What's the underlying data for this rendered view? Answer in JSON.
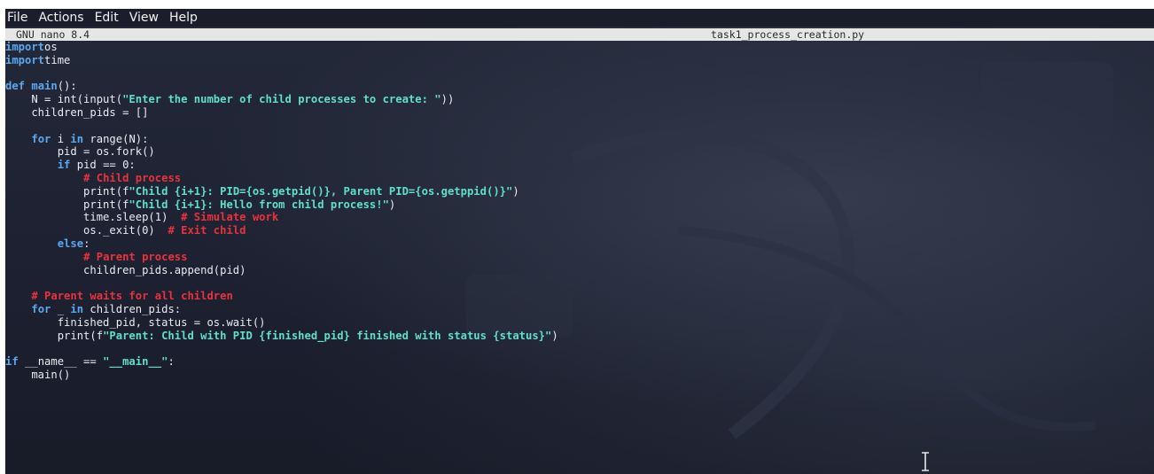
{
  "menu": {
    "items": [
      "File",
      "Actions",
      "Edit",
      "View",
      "Help"
    ]
  },
  "nano": {
    "version": "GNU nano 8.4",
    "filename": "task1_process_creation.py"
  },
  "editor": {
    "lines": [
      [
        [
          "kw",
          "import"
        ],
        [
          "",
          "os"
        ]
      ],
      [
        [
          "kw",
          "import"
        ],
        [
          "",
          "time"
        ]
      ],
      [],
      [
        [
          "kw",
          "def"
        ],
        [
          "",
          " "
        ],
        [
          "fn",
          "main"
        ],
        [
          "",
          "():"
        ]
      ],
      [
        [
          "",
          "    N = int(input("
        ],
        [
          "str",
          "\"Enter the number of child processes to create: \""
        ],
        [
          "",
          "))"
        ]
      ],
      [
        [
          "",
          "    children_pids = []"
        ]
      ],
      [],
      [
        [
          "",
          "    "
        ],
        [
          "kw",
          "for"
        ],
        [
          "",
          " i "
        ],
        [
          "kw",
          "in"
        ],
        [
          "",
          " range(N):"
        ]
      ],
      [
        [
          "",
          "        pid = os.fork()"
        ]
      ],
      [
        [
          "",
          "        "
        ],
        [
          "kw",
          "if"
        ],
        [
          "",
          " pid == 0:"
        ]
      ],
      [
        [
          "",
          "            "
        ],
        [
          "cm",
          "# Child process"
        ]
      ],
      [
        [
          "",
          "            print(f"
        ],
        [
          "str",
          "\"Child {i+1}: PID={os.getpid()}, Parent PID={os.getppid()}\""
        ],
        [
          "",
          ")"
        ]
      ],
      [
        [
          "",
          "            print(f"
        ],
        [
          "str",
          "\"Child {i+1}: Hello from child process!\""
        ],
        [
          "",
          ")"
        ]
      ],
      [
        [
          "",
          "            time.sleep(1)  "
        ],
        [
          "cm",
          "# Simulate work"
        ]
      ],
      [
        [
          "",
          "            os._exit(0)  "
        ],
        [
          "cm",
          "# Exit child"
        ]
      ],
      [
        [
          "",
          "        "
        ],
        [
          "kw",
          "else"
        ],
        [
          "",
          ":"
        ]
      ],
      [
        [
          "",
          "            "
        ],
        [
          "cm",
          "# Parent process"
        ]
      ],
      [
        [
          "",
          "            children_pids.append(pid)"
        ]
      ],
      [],
      [
        [
          "",
          "    "
        ],
        [
          "cm",
          "# Parent waits for all children"
        ]
      ],
      [
        [
          "",
          "    "
        ],
        [
          "kw",
          "for"
        ],
        [
          "",
          " _ "
        ],
        [
          "kw",
          "in"
        ],
        [
          "",
          " children_pids:"
        ]
      ],
      [
        [
          "",
          "        finished_pid, status = os.wait()"
        ]
      ],
      [
        [
          "",
          "        print(f"
        ],
        [
          "str",
          "\"Parent: Child with PID {finished_pid} finished with status {status}\""
        ],
        [
          "",
          ")"
        ]
      ],
      [],
      [
        [
          "kw",
          "if"
        ],
        [
          "",
          " __name__ == "
        ],
        [
          "str",
          "\"__main__\""
        ],
        [
          "",
          ":"
        ]
      ],
      [
        [
          "",
          "    main()"
        ]
      ]
    ]
  },
  "colors": {
    "keyword": "#5ba8f0",
    "string": "#60dec9",
    "comment": "#e8333d",
    "text": "#e9ecf2",
    "header_bg": "#e6e6e6",
    "menubar_bg": "#1b1e2a"
  },
  "mouse_cursor": {
    "icon": "i-beam-cursor-icon"
  }
}
